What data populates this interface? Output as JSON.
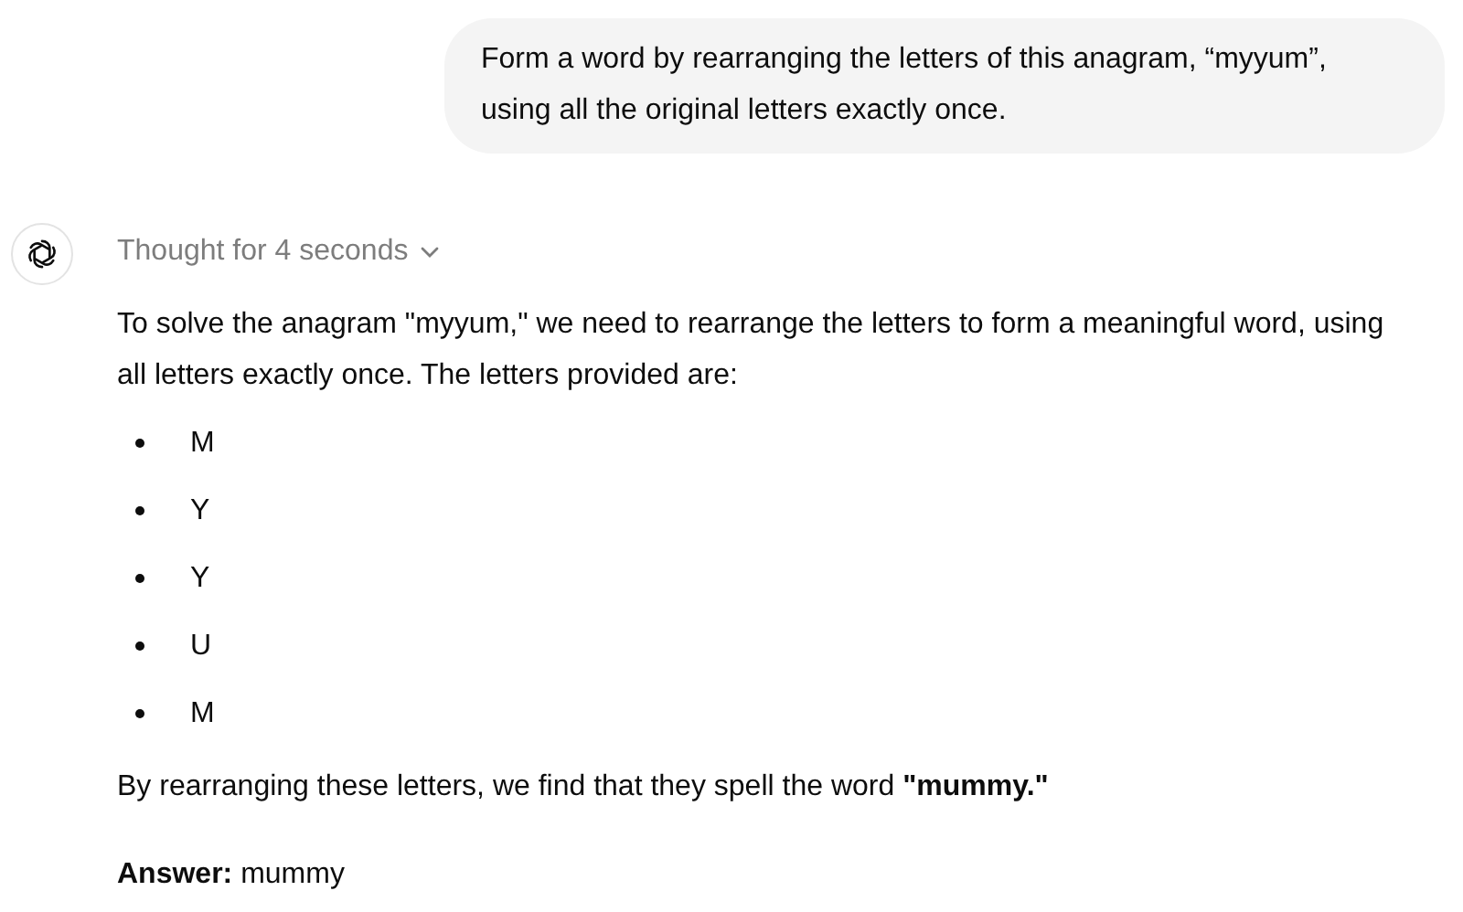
{
  "user_message": "Form a word by rearranging the letters of this anagram, “myyum”, using all the original letters exactly once.",
  "assistant": {
    "thought_toggle": {
      "label": "Thought for 4 seconds",
      "expanded": false
    },
    "intro": "To solve the anagram \"myyum,\" we need to rearrange the letters to form a meaningful word, using all letters exactly once. The letters provided are:",
    "letters": [
      "M",
      "Y",
      "Y",
      "U",
      "M"
    ],
    "conclusion": "By rearranging these letters, we find that they spell the word **\"mummy.\"**",
    "answer": "**Answer:** mummy"
  }
}
